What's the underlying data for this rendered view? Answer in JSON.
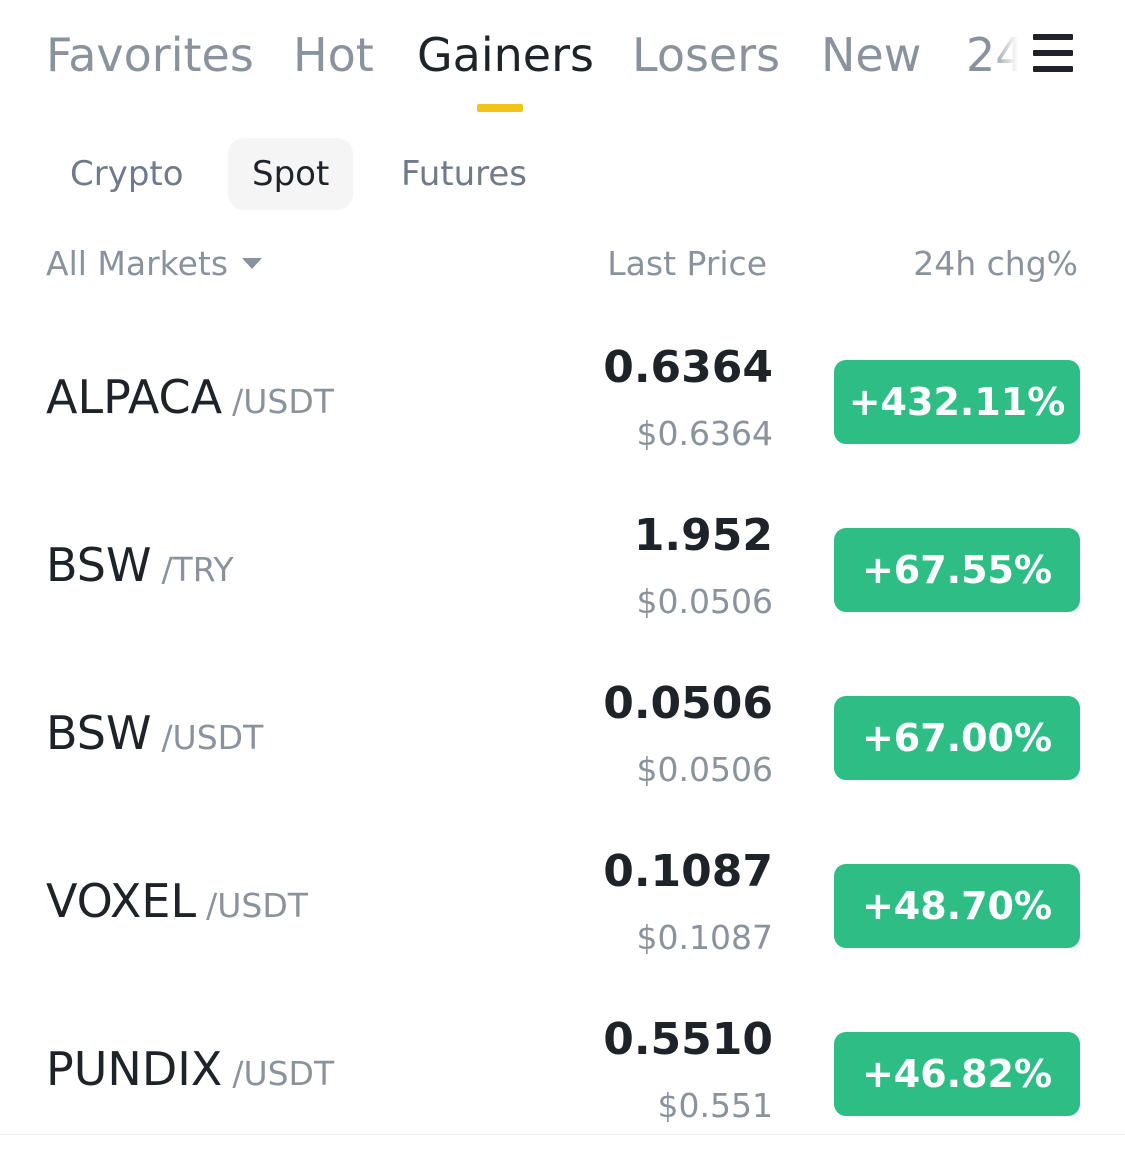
{
  "tabs": [
    {
      "label": "Favorites",
      "active": false
    },
    {
      "label": "Hot",
      "active": false
    },
    {
      "label": "Gainers",
      "active": true
    },
    {
      "label": "Losers",
      "active": false
    },
    {
      "label": "New",
      "active": false
    },
    {
      "label": "24",
      "active": false
    }
  ],
  "subtabs": [
    {
      "label": "Crypto",
      "active": false
    },
    {
      "label": "Spot",
      "active": true
    },
    {
      "label": "Futures",
      "active": false
    }
  ],
  "header": {
    "markets_label": "All Markets",
    "last_price_label": "Last Price",
    "change_label": "24h chg%"
  },
  "rows": [
    {
      "base": "ALPACA",
      "quote": "/USDT",
      "price": "0.6364",
      "fiat": "$0.6364",
      "change": "+432.11%"
    },
    {
      "base": "BSW",
      "quote": "/TRY",
      "price": "1.952",
      "fiat": "$0.0506",
      "change": "+67.55%"
    },
    {
      "base": "BSW",
      "quote": "/USDT",
      "price": "0.0506",
      "fiat": "$0.0506",
      "change": "+67.00%"
    },
    {
      "base": "VOXEL",
      "quote": "/USDT",
      "price": "0.1087",
      "fiat": "$0.1087",
      "change": "+48.70%"
    },
    {
      "base": "PUNDIX",
      "quote": "/USDT",
      "price": "0.5510",
      "fiat": "$0.551",
      "change": "+46.82%"
    }
  ],
  "colors": {
    "accent": "#F0C419",
    "positive": "#2EBD85",
    "text_primary": "#1E2329",
    "text_secondary": "#8A939D"
  },
  "icons": {
    "menu": "menu-icon",
    "dropdown": "caret-down-icon"
  }
}
